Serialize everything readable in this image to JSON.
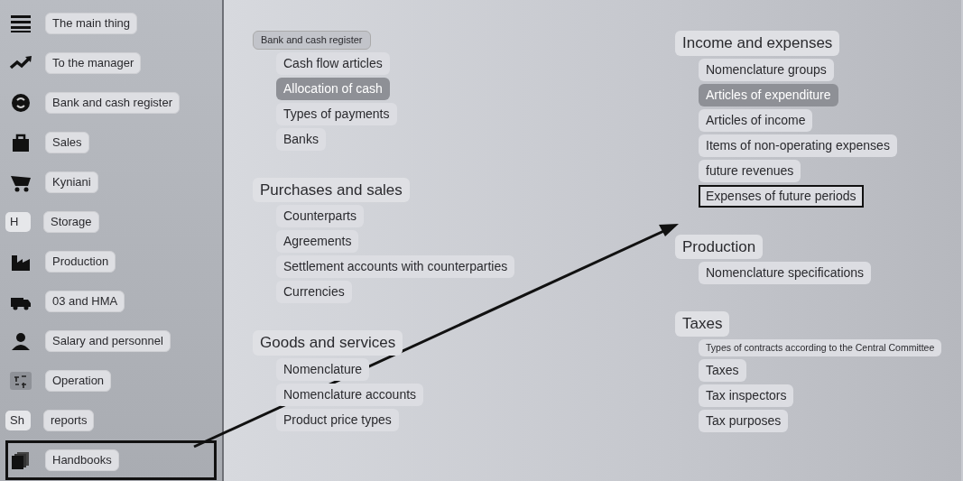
{
  "sidebar": {
    "items": [
      {
        "kind": "menu",
        "label": "The main thing",
        "highlighted": false
      },
      {
        "kind": "trend",
        "label": "To the manager",
        "highlighted": false
      },
      {
        "kind": "coin",
        "label": "Bank and cash register",
        "highlighted": false
      },
      {
        "kind": "bag",
        "label": "Sales",
        "highlighted": false
      },
      {
        "kind": "cart",
        "label": "Kyniani",
        "highlighted": false
      },
      {
        "kind": "letter",
        "badge": "H",
        "label": "Storage",
        "highlighted": false
      },
      {
        "kind": "factory",
        "label": "Production",
        "highlighted": false
      },
      {
        "kind": "truck",
        "label": "03 and HMA",
        "highlighted": false
      },
      {
        "kind": "person",
        "label": "Salary and personnel",
        "highlighted": false
      },
      {
        "kind": "ledger",
        "label": "Operation",
        "highlighted": false
      },
      {
        "kind": "letter",
        "badge": "Sh",
        "label": "reports",
        "highlighted": false
      },
      {
        "kind": "stack",
        "label": "Handbooks",
        "highlighted": true
      }
    ]
  },
  "columns": [
    [
      {
        "title": "Bank and cash register",
        "items": [
          {
            "label": "Cash flow articles",
            "selected": false,
            "highlighted": false
          },
          {
            "label": "Allocation of cash",
            "selected": true,
            "highlighted": false
          },
          {
            "label": "Types of payments",
            "selected": false,
            "highlighted": false
          },
          {
            "label": "Banks",
            "selected": false,
            "highlighted": false
          }
        ]
      },
      {
        "title": "Purchases and sales",
        "items": [
          {
            "label": "Counterparts",
            "selected": false,
            "highlighted": false
          },
          {
            "label": "Agreements",
            "selected": false,
            "highlighted": false
          },
          {
            "label": "Settlement accounts with counterparties",
            "selected": false,
            "highlighted": false
          },
          {
            "label": "Currencies",
            "selected": false,
            "highlighted": false
          }
        ]
      },
      {
        "title": "Goods and services",
        "items": [
          {
            "label": "Nomenclature",
            "selected": false,
            "highlighted": false
          },
          {
            "label": "Nomenclature accounts",
            "selected": false,
            "highlighted": false
          },
          {
            "label": "Product price types",
            "selected": false,
            "highlighted": false
          }
        ]
      }
    ],
    [
      {
        "title": "Income and expenses",
        "items": [
          {
            "label": "Nomenclature groups",
            "selected": false,
            "highlighted": false
          },
          {
            "label": "Articles of expenditure",
            "selected": true,
            "highlighted": false
          },
          {
            "label": "Articles of income",
            "selected": false,
            "highlighted": false
          },
          {
            "label": "Items of non-operating expenses",
            "selected": false,
            "highlighted": false
          },
          {
            "label": "future revenues",
            "selected": false,
            "highlighted": false
          },
          {
            "label": "Expenses of future periods",
            "selected": false,
            "highlighted": true
          }
        ]
      },
      {
        "title": "Production",
        "items": [
          {
            "label": "Nomenclature specifications",
            "selected": false,
            "highlighted": false
          }
        ]
      },
      {
        "title": "Taxes",
        "items": [
          {
            "label": "Types of contracts according to the Central Committee",
            "selected": false,
            "highlighted": false
          },
          {
            "label": "Taxes",
            "selected": false,
            "highlighted": false
          },
          {
            "label": "Tax inspectors",
            "selected": false,
            "highlighted": false
          },
          {
            "label": "Tax purposes",
            "selected": false,
            "highlighted": false
          }
        ]
      }
    ]
  ]
}
